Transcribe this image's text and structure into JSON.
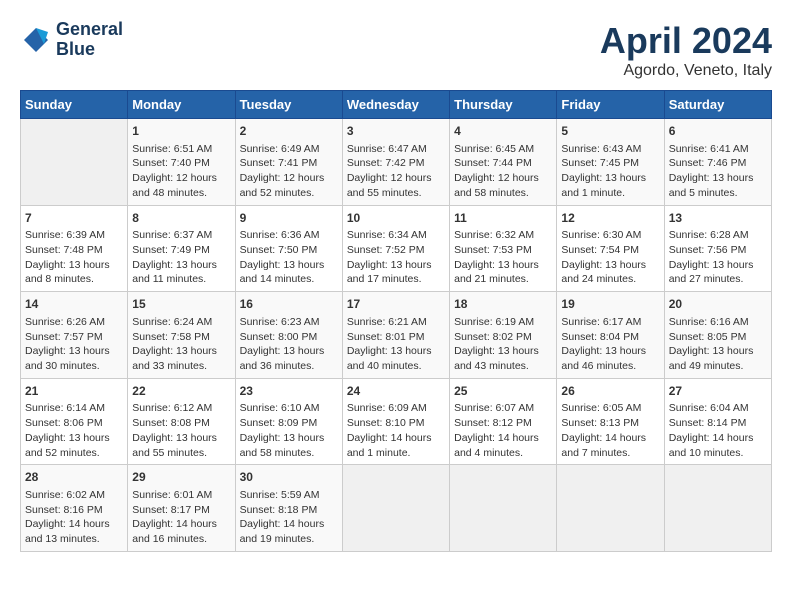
{
  "header": {
    "logo_line1": "General",
    "logo_line2": "Blue",
    "title": "April 2024",
    "subtitle": "Agordo, Veneto, Italy"
  },
  "calendar": {
    "days_of_week": [
      "Sunday",
      "Monday",
      "Tuesday",
      "Wednesday",
      "Thursday",
      "Friday",
      "Saturday"
    ],
    "weeks": [
      [
        {
          "day": "",
          "info": ""
        },
        {
          "day": "1",
          "info": "Sunrise: 6:51 AM\nSunset: 7:40 PM\nDaylight: 12 hours\nand 48 minutes."
        },
        {
          "day": "2",
          "info": "Sunrise: 6:49 AM\nSunset: 7:41 PM\nDaylight: 12 hours\nand 52 minutes."
        },
        {
          "day": "3",
          "info": "Sunrise: 6:47 AM\nSunset: 7:42 PM\nDaylight: 12 hours\nand 55 minutes."
        },
        {
          "day": "4",
          "info": "Sunrise: 6:45 AM\nSunset: 7:44 PM\nDaylight: 12 hours\nand 58 minutes."
        },
        {
          "day": "5",
          "info": "Sunrise: 6:43 AM\nSunset: 7:45 PM\nDaylight: 13 hours\nand 1 minute."
        },
        {
          "day": "6",
          "info": "Sunrise: 6:41 AM\nSunset: 7:46 PM\nDaylight: 13 hours\nand 5 minutes."
        }
      ],
      [
        {
          "day": "7",
          "info": "Sunrise: 6:39 AM\nSunset: 7:48 PM\nDaylight: 13 hours\nand 8 minutes."
        },
        {
          "day": "8",
          "info": "Sunrise: 6:37 AM\nSunset: 7:49 PM\nDaylight: 13 hours\nand 11 minutes."
        },
        {
          "day": "9",
          "info": "Sunrise: 6:36 AM\nSunset: 7:50 PM\nDaylight: 13 hours\nand 14 minutes."
        },
        {
          "day": "10",
          "info": "Sunrise: 6:34 AM\nSunset: 7:52 PM\nDaylight: 13 hours\nand 17 minutes."
        },
        {
          "day": "11",
          "info": "Sunrise: 6:32 AM\nSunset: 7:53 PM\nDaylight: 13 hours\nand 21 minutes."
        },
        {
          "day": "12",
          "info": "Sunrise: 6:30 AM\nSunset: 7:54 PM\nDaylight: 13 hours\nand 24 minutes."
        },
        {
          "day": "13",
          "info": "Sunrise: 6:28 AM\nSunset: 7:56 PM\nDaylight: 13 hours\nand 27 minutes."
        }
      ],
      [
        {
          "day": "14",
          "info": "Sunrise: 6:26 AM\nSunset: 7:57 PM\nDaylight: 13 hours\nand 30 minutes."
        },
        {
          "day": "15",
          "info": "Sunrise: 6:24 AM\nSunset: 7:58 PM\nDaylight: 13 hours\nand 33 minutes."
        },
        {
          "day": "16",
          "info": "Sunrise: 6:23 AM\nSunset: 8:00 PM\nDaylight: 13 hours\nand 36 minutes."
        },
        {
          "day": "17",
          "info": "Sunrise: 6:21 AM\nSunset: 8:01 PM\nDaylight: 13 hours\nand 40 minutes."
        },
        {
          "day": "18",
          "info": "Sunrise: 6:19 AM\nSunset: 8:02 PM\nDaylight: 13 hours\nand 43 minutes."
        },
        {
          "day": "19",
          "info": "Sunrise: 6:17 AM\nSunset: 8:04 PM\nDaylight: 13 hours\nand 46 minutes."
        },
        {
          "day": "20",
          "info": "Sunrise: 6:16 AM\nSunset: 8:05 PM\nDaylight: 13 hours\nand 49 minutes."
        }
      ],
      [
        {
          "day": "21",
          "info": "Sunrise: 6:14 AM\nSunset: 8:06 PM\nDaylight: 13 hours\nand 52 minutes."
        },
        {
          "day": "22",
          "info": "Sunrise: 6:12 AM\nSunset: 8:08 PM\nDaylight: 13 hours\nand 55 minutes."
        },
        {
          "day": "23",
          "info": "Sunrise: 6:10 AM\nSunset: 8:09 PM\nDaylight: 13 hours\nand 58 minutes."
        },
        {
          "day": "24",
          "info": "Sunrise: 6:09 AM\nSunset: 8:10 PM\nDaylight: 14 hours\nand 1 minute."
        },
        {
          "day": "25",
          "info": "Sunrise: 6:07 AM\nSunset: 8:12 PM\nDaylight: 14 hours\nand 4 minutes."
        },
        {
          "day": "26",
          "info": "Sunrise: 6:05 AM\nSunset: 8:13 PM\nDaylight: 14 hours\nand 7 minutes."
        },
        {
          "day": "27",
          "info": "Sunrise: 6:04 AM\nSunset: 8:14 PM\nDaylight: 14 hours\nand 10 minutes."
        }
      ],
      [
        {
          "day": "28",
          "info": "Sunrise: 6:02 AM\nSunset: 8:16 PM\nDaylight: 14 hours\nand 13 minutes."
        },
        {
          "day": "29",
          "info": "Sunrise: 6:01 AM\nSunset: 8:17 PM\nDaylight: 14 hours\nand 16 minutes."
        },
        {
          "day": "30",
          "info": "Sunrise: 5:59 AM\nSunset: 8:18 PM\nDaylight: 14 hours\nand 19 minutes."
        },
        {
          "day": "",
          "info": ""
        },
        {
          "day": "",
          "info": ""
        },
        {
          "day": "",
          "info": ""
        },
        {
          "day": "",
          "info": ""
        }
      ]
    ]
  }
}
